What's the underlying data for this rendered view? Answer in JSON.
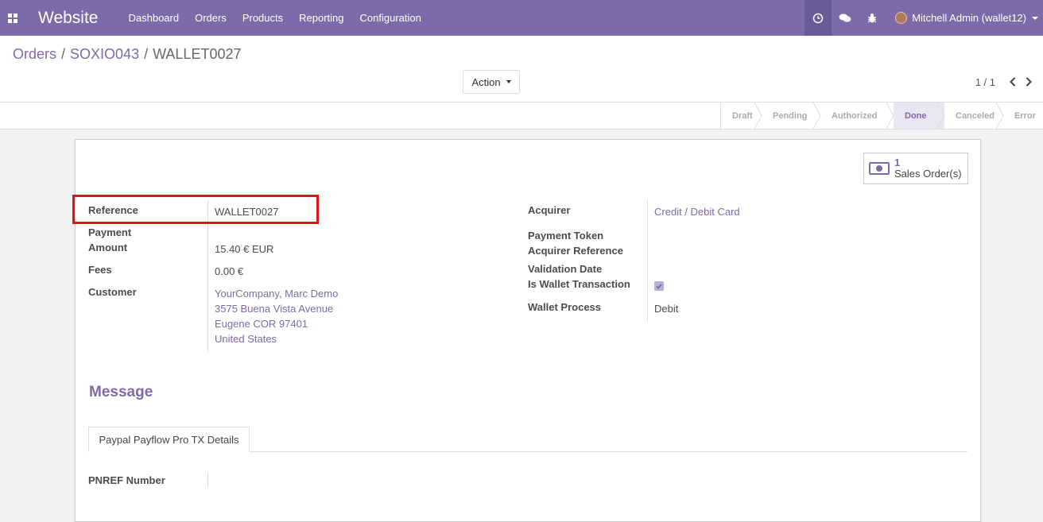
{
  "navbar": {
    "app_title": "Website",
    "menu": [
      "Dashboard",
      "Orders",
      "Products",
      "Reporting",
      "Configuration"
    ],
    "user": "Mitchell Admin (wallet12)"
  },
  "breadcrumb": [
    "Orders",
    "SOXIO043",
    "WALLET0027"
  ],
  "control": {
    "action_label": "Action",
    "pager": "1 / 1"
  },
  "status": {
    "stages": [
      "Draft",
      "Pending",
      "Authorized",
      "Done",
      "Canceled",
      "Error"
    ],
    "current": "Done"
  },
  "smart_button": {
    "count": "1",
    "label": "Sales Order(s)"
  },
  "left_fields": {
    "reference_label": "Reference",
    "reference_value": "WALLET0027",
    "payment_amount_label_1": "Payment",
    "payment_amount_label_2": "Amount",
    "payment_amount_value": "15.40 € EUR",
    "fees_label": "Fees",
    "fees_value": "0.00 €",
    "customer_label": "Customer",
    "customer_lines": [
      "YourCompany, Marc Demo",
      "3575 Buena Vista Avenue",
      "Eugene COR 97401",
      "United States"
    ]
  },
  "right_fields": {
    "acquirer_label": "Acquirer",
    "acquirer_value": "Credit / Debit Card",
    "payment_token_label": "Payment Token",
    "acquirer_reference_label": "Acquirer Reference",
    "validation_date_label": "Validation Date",
    "is_wallet_label": "Is Wallet Transaction",
    "is_wallet_checked": true,
    "wallet_process_label": "Wallet Process",
    "wallet_process_value": "Debit"
  },
  "message_title": "Message",
  "tabs": [
    "Paypal Payflow Pro TX Details"
  ],
  "tab_fields": {
    "pnref_label": "PNREF Number"
  },
  "colors": {
    "brand": "#7c6ba8",
    "highlight": "#e0131b"
  }
}
